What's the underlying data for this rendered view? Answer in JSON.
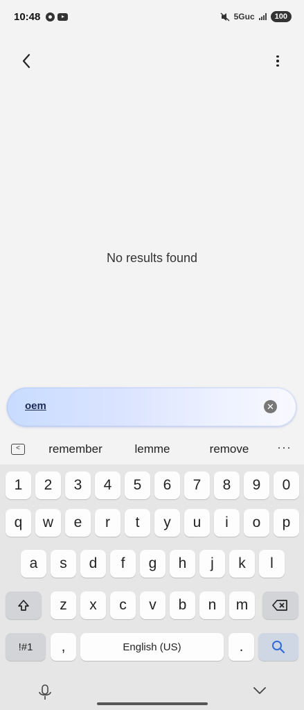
{
  "status_bar": {
    "time": "10:48",
    "network": "5Guc",
    "battery": "100",
    "left_icons": [
      "record-icon",
      "youtube-icon"
    ],
    "right_icons": [
      "mute-icon",
      "signal-icon",
      "battery-icon"
    ]
  },
  "header": {
    "back_icon": "back-arrow-icon",
    "menu_icon": "more-vertical-icon"
  },
  "results": {
    "empty_message": "No results found"
  },
  "search": {
    "query": "oem",
    "clear_icon": "clear-icon",
    "accent_color": "#c8dcff"
  },
  "suggestions": {
    "items": [
      "remember",
      "lemme",
      "remove"
    ],
    "more_label": "···"
  },
  "keyboard": {
    "row_numbers": [
      "1",
      "2",
      "3",
      "4",
      "5",
      "6",
      "7",
      "8",
      "9",
      "0"
    ],
    "row_1": [
      "q",
      "w",
      "e",
      "r",
      "t",
      "y",
      "u",
      "i",
      "o",
      "p"
    ],
    "row_2": [
      "a",
      "s",
      "d",
      "f",
      "g",
      "h",
      "j",
      "k",
      "l"
    ],
    "row_3": [
      "z",
      "x",
      "c",
      "v",
      "b",
      "n",
      "m"
    ],
    "symbols_label": "!#1",
    "comma_label": ",",
    "space_label": "English (US)",
    "period_label": ".",
    "search_key_color": "#2f6bd6"
  }
}
